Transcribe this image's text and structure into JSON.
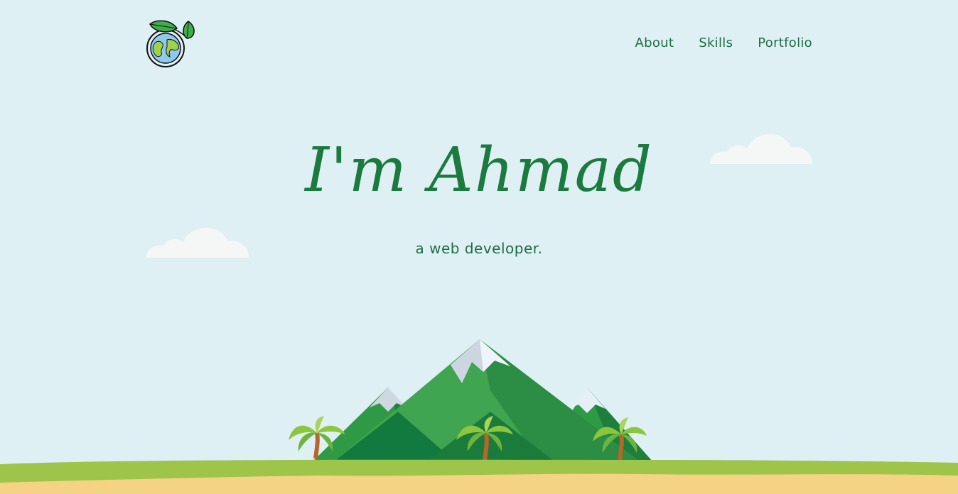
{
  "header": {
    "logo_icon": "earth-leaves-icon",
    "nav": [
      {
        "label": "About"
      },
      {
        "label": "Skills"
      },
      {
        "label": "Portfolio"
      }
    ]
  },
  "hero": {
    "title": "I'm Ahmad",
    "subtitle": "a web developer."
  },
  "scene": {
    "icons": [
      "cloud-icon",
      "mountain-icon",
      "palm-tree-icon"
    ],
    "colors": {
      "sky": "#dff0f5",
      "text_green": "#1f6d43",
      "grass": "#9ec449",
      "sand": "#f5d384",
      "mountain_dark": "#147a3e",
      "mountain_light": "#43a84f",
      "snow": "#eef4fa"
    }
  }
}
